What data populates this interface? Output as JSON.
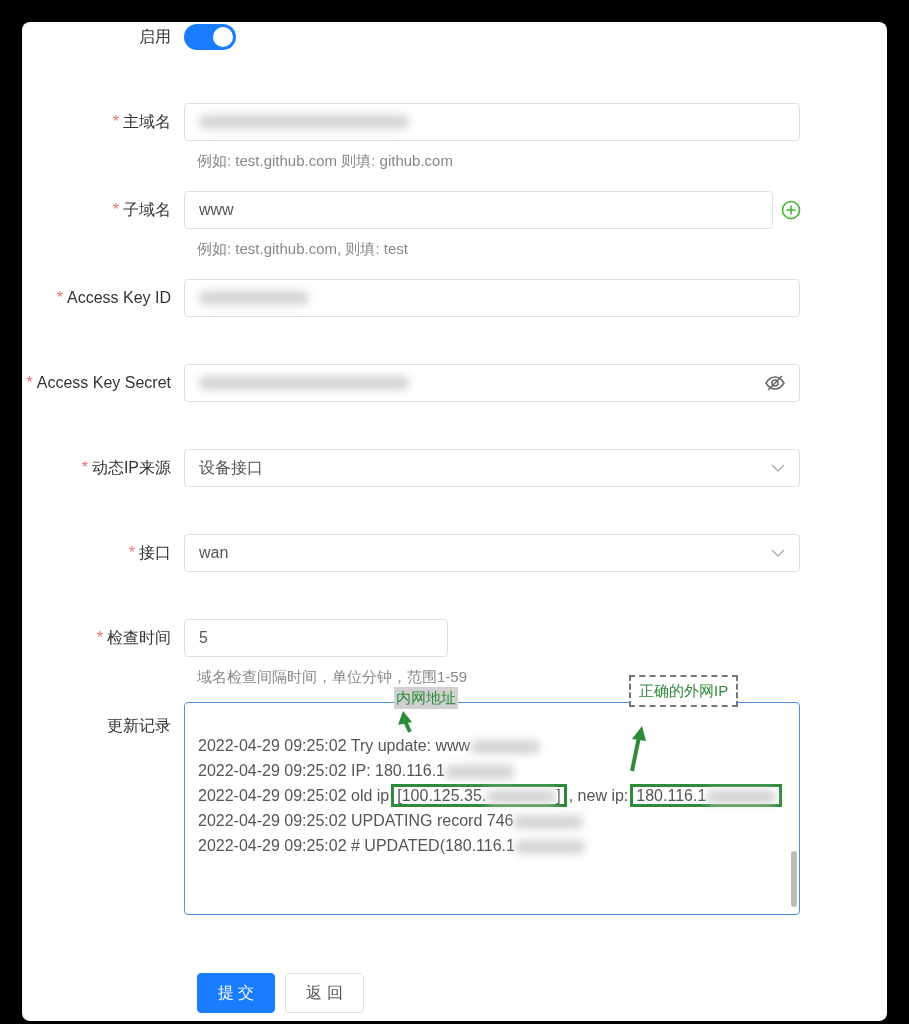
{
  "form": {
    "fields": [
      {
        "kind": "switch",
        "label": "启用",
        "on": true
      },
      {
        "kind": "text",
        "label": "主域名",
        "required_mark": "*",
        "redacted": true,
        "hint": "例如: test.github.com 则填: github.com"
      },
      {
        "kind": "text",
        "label": "子域名",
        "required_mark": "*",
        "value": "www",
        "add_button": true,
        "hint": "例如: test.github.com, 则填: test"
      },
      {
        "kind": "text",
        "label": "Access Key ID",
        "required_mark": "*",
        "redacted": true
      },
      {
        "kind": "password",
        "label": "Access Key Secret",
        "required_mark": "*",
        "redacted": true
      },
      {
        "kind": "select",
        "label": "动态IP来源",
        "required_mark": "*",
        "value": "设备接口"
      },
      {
        "kind": "select",
        "label": "接口",
        "required_mark": "*",
        "value": "wan"
      },
      {
        "kind": "short",
        "label": "检查时间",
        "required_mark": "*",
        "value": "5",
        "hint": "域名检查间隔时间，单位分钟，范围1-59"
      },
      {
        "kind": "log",
        "label": "更新记录",
        "lines": [
          {
            "parts": [
              {
                "kind": "text",
                "text": "2022-04-29 09:25:02 Try update: www"
              },
              {
                "kind": "redacted"
              }
            ]
          },
          {
            "parts": [
              {
                "kind": "text",
                "text": "2022-04-29 09:25:02 IP: 180.116.1"
              },
              {
                "kind": "redacted"
              }
            ]
          },
          {
            "parts": [
              {
                "kind": "text",
                "text": "2022-04-29 09:25:02 old ip"
              },
              {
                "kind": "boxed",
                "parts": [
                  {
                    "kind": "text",
                    "text": "[100.125.35."
                  },
                  {
                    "kind": "redacted"
                  },
                  {
                    "kind": "text",
                    "text": "]"
                  }
                ]
              },
              {
                "kind": "text",
                "text": ", new ip:"
              },
              {
                "kind": "boxed",
                "parts": [
                  {
                    "kind": "text",
                    "text": "180.116.1"
                  },
                  {
                    "kind": "redacted"
                  }
                ]
              }
            ]
          },
          {
            "parts": [
              {
                "kind": "text",
                "text": "2022-04-29 09:25:02 UPDATING record 746"
              },
              {
                "kind": "redacted"
              }
            ]
          },
          {
            "parts": [
              {
                "kind": "text",
                "text": "2022-04-29 09:25:02 # UPDATED(180.116.1"
              },
              {
                "kind": "redacted"
              }
            ]
          }
        ]
      }
    ]
  },
  "annotations": [
    {
      "kind": "shaded",
      "text": "内网地址"
    },
    {
      "kind": "dashed",
      "text": "正确的外网IP"
    }
  ],
  "buttons": [
    {
      "kind": "primary",
      "label": "提 交"
    },
    {
      "kind": "default",
      "label": "返 回"
    }
  ]
}
